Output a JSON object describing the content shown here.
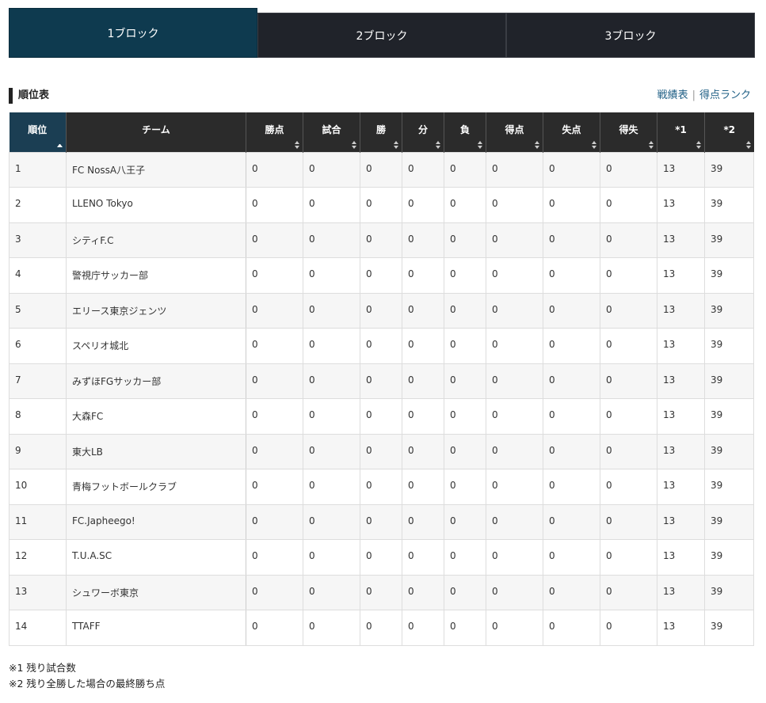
{
  "tabs": [
    {
      "label": "1ブロック",
      "active": true
    },
    {
      "label": "2ブロック",
      "active": false
    },
    {
      "label": "3ブロック",
      "active": false
    }
  ],
  "section": {
    "title": "順位表",
    "links": [
      "戦績表",
      "得点ランク"
    ],
    "separator": "|"
  },
  "table": {
    "headers": [
      "順位",
      "チーム",
      "勝点",
      "試合",
      "勝",
      "分",
      "負",
      "得点",
      "失点",
      "得失",
      "*1",
      "*2"
    ],
    "rows": [
      [
        "1",
        "FC NossA八王子",
        "0",
        "0",
        "0",
        "0",
        "0",
        "0",
        "0",
        "0",
        "13",
        "39"
      ],
      [
        "2",
        "LLENO Tokyo",
        "0",
        "0",
        "0",
        "0",
        "0",
        "0",
        "0",
        "0",
        "13",
        "39"
      ],
      [
        "3",
        "シティF.C",
        "0",
        "0",
        "0",
        "0",
        "0",
        "0",
        "0",
        "0",
        "13",
        "39"
      ],
      [
        "4",
        "警視庁サッカー部",
        "0",
        "0",
        "0",
        "0",
        "0",
        "0",
        "0",
        "0",
        "13",
        "39"
      ],
      [
        "5",
        "エリース東京ジェンツ",
        "0",
        "0",
        "0",
        "0",
        "0",
        "0",
        "0",
        "0",
        "13",
        "39"
      ],
      [
        "6",
        "スペリオ城北",
        "0",
        "0",
        "0",
        "0",
        "0",
        "0",
        "0",
        "0",
        "13",
        "39"
      ],
      [
        "7",
        "みずほFGサッカー部",
        "0",
        "0",
        "0",
        "0",
        "0",
        "0",
        "0",
        "0",
        "13",
        "39"
      ],
      [
        "8",
        "大森FC",
        "0",
        "0",
        "0",
        "0",
        "0",
        "0",
        "0",
        "0",
        "13",
        "39"
      ],
      [
        "9",
        "東大LB",
        "0",
        "0",
        "0",
        "0",
        "0",
        "0",
        "0",
        "0",
        "13",
        "39"
      ],
      [
        "10",
        "青梅フットボールクラブ",
        "0",
        "0",
        "0",
        "0",
        "0",
        "0",
        "0",
        "0",
        "13",
        "39"
      ],
      [
        "11",
        "FC.Japheego!",
        "0",
        "0",
        "0",
        "0",
        "0",
        "0",
        "0",
        "0",
        "13",
        "39"
      ],
      [
        "12",
        "T.U.A.SC",
        "0",
        "0",
        "0",
        "0",
        "0",
        "0",
        "0",
        "0",
        "13",
        "39"
      ],
      [
        "13",
        "シュワーボ東京",
        "0",
        "0",
        "0",
        "0",
        "0",
        "0",
        "0",
        "0",
        "13",
        "39"
      ],
      [
        "14",
        "TTAFF",
        "0",
        "0",
        "0",
        "0",
        "0",
        "0",
        "0",
        "0",
        "13",
        "39"
      ]
    ]
  },
  "notes": [
    "※1 残り試合数",
    "※2 残り全勝した場合の最終勝ち点"
  ]
}
